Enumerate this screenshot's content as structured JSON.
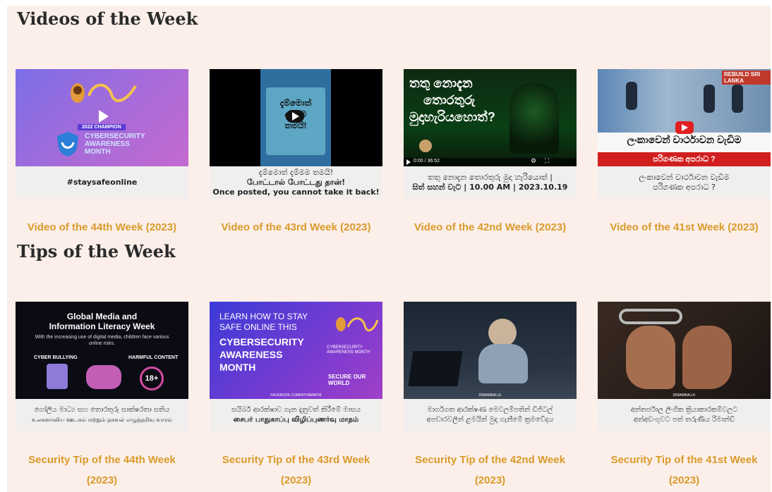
{
  "sections": {
    "videos_title": "Videos of the Week",
    "tips_title": "Tips of the Week"
  },
  "videos": [
    {
      "thumb_text": {
        "champion": "2022 CHAMPION",
        "line1": "CYBERSECURITY",
        "line2": "AWARENESS",
        "line3": "MONTH"
      },
      "caption": [
        "#staysafeonline"
      ],
      "title": "Video of the 44th Week (2023)"
    },
    {
      "thumb_text": {
        "line1": "දැම්මොත්",
        "line2": "දැම්මම",
        "line3": "තමයි!"
      },
      "caption": [
        "දැම්මොත් දැම්මම තමයි!",
        "போட்டால் போட்டது தான்!",
        "Once posted, you cannot take it back!"
      ],
      "title": "Video of the 43rd Week (2023)"
    },
    {
      "thumb_text": {
        "line1": "තතු නොදැන",
        "line2": "තොරතුරු",
        "line3": "මුදාහැරියහොත්?",
        "time": "0:00 / 36:52"
      },
      "caption": [
        "තතු නොදැන තොරතුරු මුදා හැරියොත් |",
        "සිත් සහන් වැට | 10.00 AM | 2023.10.19"
      ],
      "title": "Video of the 42nd Week (2023)"
    },
    {
      "thumb_text": {
        "banner": "ලංකාවෙන් වාර්ථාවන වැඩිම",
        "sub": "පරිගණක අපරාධ ?",
        "logo": "REBUILD SRI LANKA"
      },
      "caption": [
        "ලංකාවෙන් වාර්ථාවන වැඩිම",
        "පරිගණක අපරාධ ?"
      ],
      "title": "Video of the 41st Week (2023)"
    }
  ],
  "tips": [
    {
      "thumb_text": {
        "line1": "Global Media and",
        "line2": "Information Literacy Week",
        "body": "With the increasing use of digital media, children face various online risks.",
        "left": "CYBER BULLYING",
        "right": "HARMFUL CONTENT",
        "badge": "18+"
      },
      "caption": [
        "ගෝලීය මාධ්‍ය සහ තොරතුරු සාක්ෂරතා සතිය",
        "உலகளாவிய ஊடகம் மற்றும் தகவல் எழுத்தறிவு வாரம்"
      ],
      "title": "Security Tip of the 44th Week (2023)"
    },
    {
      "thumb_text": {
        "line1": "LEARN HOW TO STAY",
        "line2": "SAFE ONLINE THIS",
        "line3": "CYBERSECURITY",
        "line4": "AWARENESS",
        "line5": "MONTH",
        "badge1": "CYBERSECURITY AWARENESS MONTH",
        "badge2": "SECURE OUR WORLD",
        "footer": "FACEBOOK.COM/HITHAWATHI"
      },
      "caption": [
        "සයිබර් ආරක්ෂාව ගැන දැනුවත් කිරීමේ මාසය",
        "சைபர் பாதுகாப்பு விழிப்புணர்வு மாதம்"
      ],
      "title": "Security Tip of the 43rd Week (2023)"
    },
    {
      "thumb_text": {
        "footer": "DINAMINA.LK"
      },
      "caption": [
        "මාර්ගගත ආරක්ෂණ මෙවලම්පතින් ඩිජිටල්",
        "අපචාරවලින් ළමයින් මුදා ගැනීමේ ක්‍රමවේදය"
      ],
      "title": "Security Tip of the 42nd Week (2023)"
    },
    {
      "thumb_text": {
        "footer": "DINAMINA.LK"
      },
      "caption": [
        "අන්තර්ජාල ලිංගික ක්‍රියාකාරකම්වලට",
        "අත්අඩංගුවට පත් තරුණිය රිමාන්ඩ්"
      ],
      "title": "Security Tip of the 41st Week (2023)"
    }
  ],
  "colors": {
    "background": "#fcefe9",
    "title_link": "#d99a2a",
    "heading": "#2b2b2b"
  }
}
